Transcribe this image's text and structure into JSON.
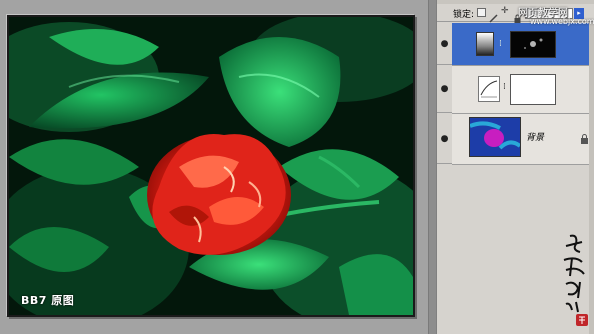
{
  "image": {
    "caption": "BB7 原图"
  },
  "layers_panel": {
    "lock_label": "锁定:",
    "fill_value": "",
    "layers": [
      {
        "name": "",
        "selected": true
      },
      {
        "name": "",
        "selected": false
      },
      {
        "name": "背景",
        "selected": false
      }
    ]
  },
  "watermark": {
    "site": "网页教学网",
    "url": "www.webjx.com"
  }
}
